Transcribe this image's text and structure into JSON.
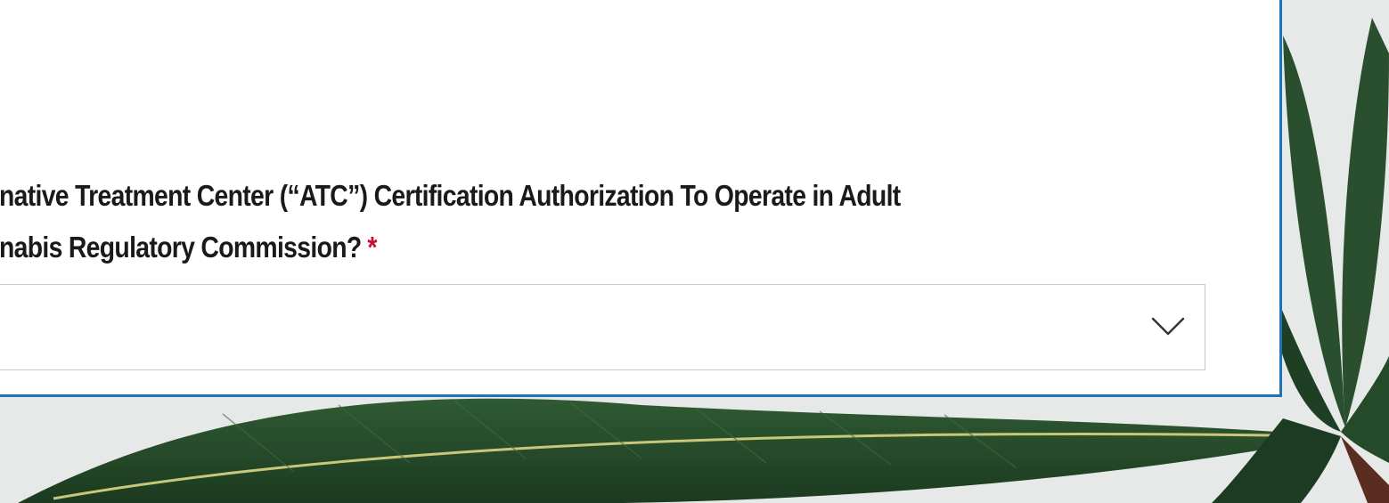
{
  "form": {
    "question_line1": "native Treatment Center (“ATC”) Certification Authorization To Operate in Adult",
    "question_line2": "nabis Regulatory Commission?",
    "required_marker": "*",
    "select": {
      "selected_value": ""
    }
  },
  "icons": {
    "dropdown": "chevron-down-icon"
  },
  "colors": {
    "card_border": "#1f73b7",
    "required": "#c8102e",
    "leaf": "#24462a"
  }
}
